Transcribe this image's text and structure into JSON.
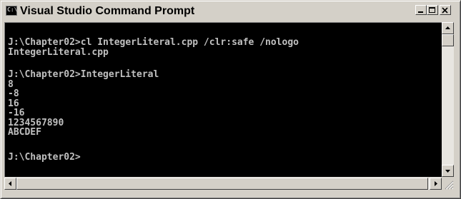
{
  "window": {
    "title": "Visual Studio Command Prompt",
    "icon_name": "console-app-icon",
    "icon_text": "C:\\",
    "accent_colors": {
      "console_bg": "#000000",
      "console_text": "#c0c0c0",
      "chrome": "#d4d0c8"
    }
  },
  "titlebar_buttons": [
    {
      "name": "minimize-button",
      "icon": "minimize-icon"
    },
    {
      "name": "maximize-button",
      "icon": "maximize-icon"
    },
    {
      "name": "close-button",
      "icon": "close-icon"
    }
  ],
  "console": {
    "lines": [
      "J:\\Chapter02>cl IntegerLiteral.cpp /clr:safe /nologo",
      "IntegerLiteral.cpp",
      "",
      "J:\\Chapter02>IntegerLiteral",
      "8",
      "-8",
      "16",
      "-16",
      "1234567890",
      "ABCDEF",
      "",
      "J:\\Chapter02>"
    ]
  },
  "scrollbars": {
    "vertical": {
      "icons": [
        "scroll-up-arrow-icon",
        "scroll-down-arrow-icon"
      ],
      "position": 0.0
    },
    "horizontal": {
      "icons": [
        "scroll-left-arrow-icon",
        "scroll-right-arrow-icon"
      ],
      "position": 0.0
    }
  }
}
